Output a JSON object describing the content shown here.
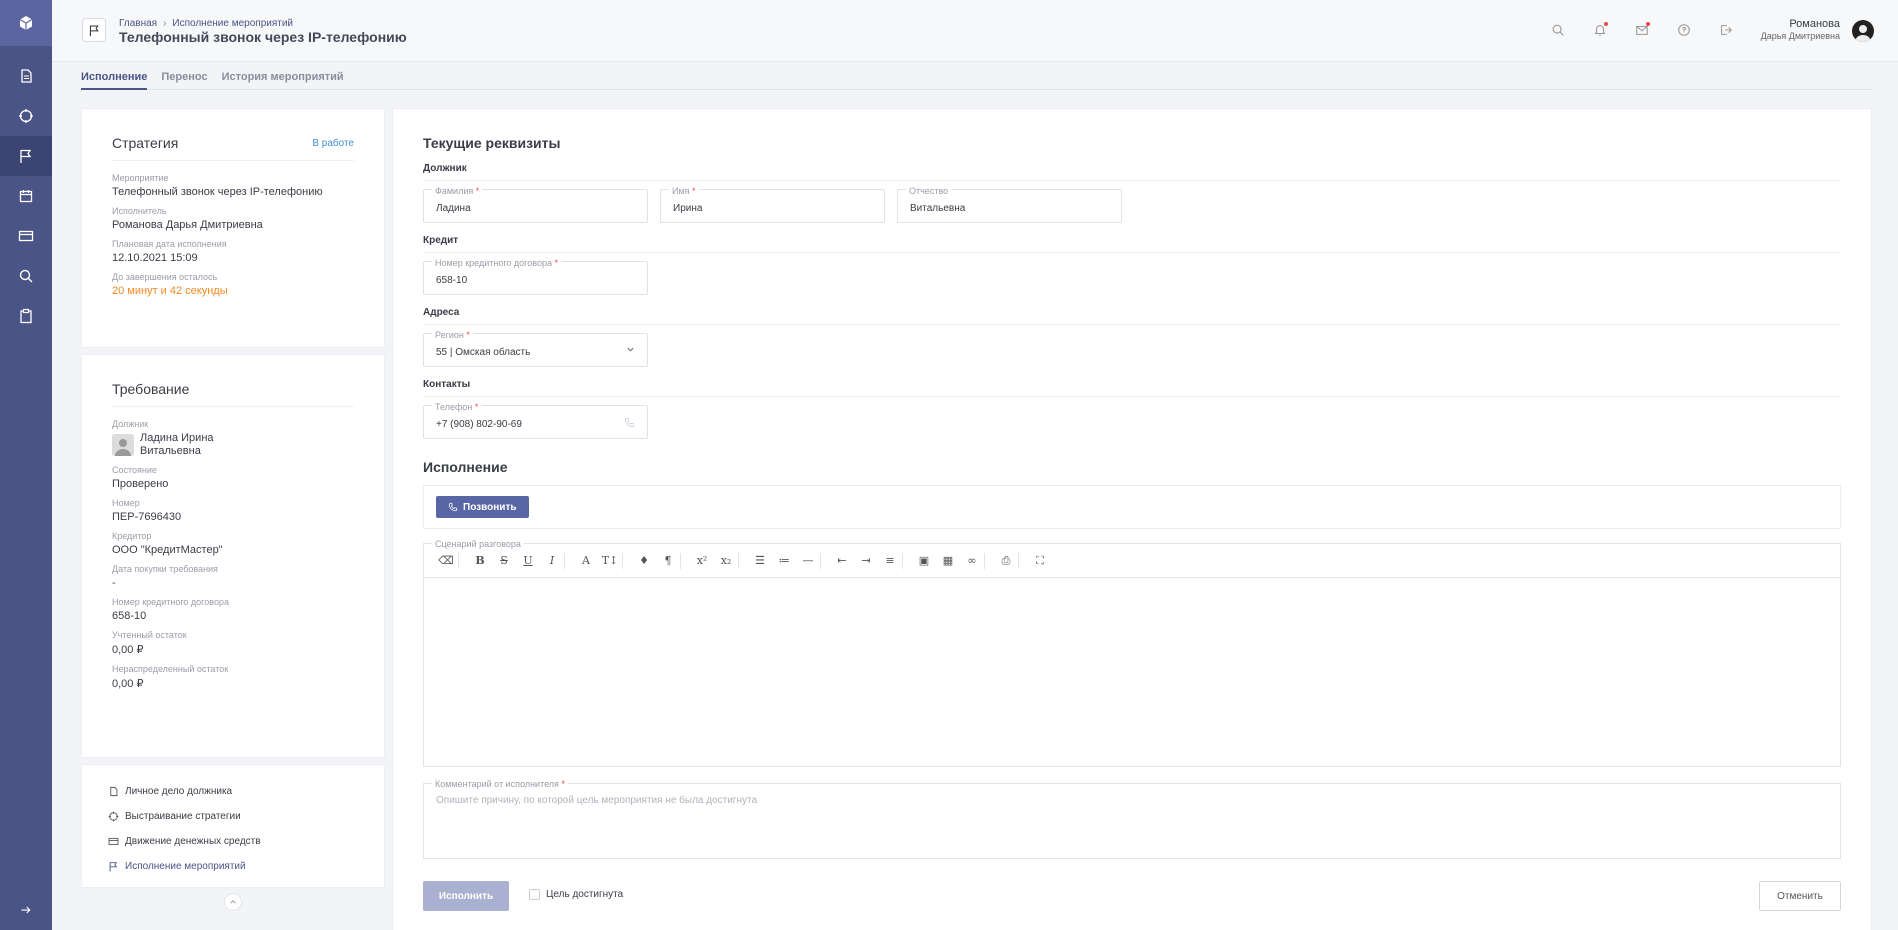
{
  "breadcrumb": {
    "home": "Главная",
    "section": "Исполнение мероприятий"
  },
  "page_title": "Телефонный звонок через IP-телефонию",
  "user": {
    "surname": "Романова",
    "name": "Дарья Дмитриевна"
  },
  "tabs": [
    {
      "label": "Исполнение",
      "active": true
    },
    {
      "label": "Перенос",
      "active": false
    },
    {
      "label": "История мероприятий",
      "active": false
    }
  ],
  "strategy": {
    "title": "Стратегия",
    "status": "В работе",
    "fields": [
      {
        "label": "Мероприятие",
        "value": "Телефонный звонок через IP-телефонию"
      },
      {
        "label": "Исполнитель",
        "value": "Романова Дарья Дмитриевна"
      },
      {
        "label": "Плановая дата исполнения",
        "value": "12.10.2021 15:09"
      },
      {
        "label": "До завершения осталось",
        "value": "20 минут и 42 секунды"
      }
    ]
  },
  "requirement": {
    "title": "Требование",
    "debtor_label": "Должник",
    "debtor_line1": "Ладина Ирина",
    "debtor_line2": "Витальевна",
    "fields": [
      {
        "label": "Состояние",
        "value": "Проверено"
      },
      {
        "label": "Номер",
        "value": "ПЕР-7696430"
      },
      {
        "label": "Кредитор",
        "value": "ООО \"КредитМастер\""
      },
      {
        "label": "Дата покупки требования",
        "value": "-"
      },
      {
        "label": "Номер кредитного договора",
        "value": "658-10"
      },
      {
        "label": "Учтенный остаток",
        "value": "0,00 ₽"
      },
      {
        "label": "Нераспределенный остаток",
        "value": "0,00 ₽"
      }
    ]
  },
  "links": [
    {
      "label": "Личное дело должника",
      "icon": "document-icon"
    },
    {
      "label": "Выстраивание стратегии",
      "icon": "target-icon"
    },
    {
      "label": "Движение денежных средств",
      "icon": "card-icon"
    },
    {
      "label": "Исполнение мероприятий",
      "icon": "flag-icon"
    }
  ],
  "main": {
    "title": "Текущие реквизиты",
    "debtor_group": "Должник",
    "surname_label": "Фамилия",
    "surname_value": "Ладина",
    "name_label": "Имя",
    "name_value": "Ирина",
    "patronymic_label": "Отчество",
    "patronymic_value": "Витальевна",
    "credit_group": "Кредит",
    "contract_label": "Номер кредитного договора",
    "contract_value": "658-10",
    "address_group": "Адреса",
    "region_label": "Регион",
    "region_value": "55 | Омская область",
    "contacts_group": "Контакты",
    "phone_label": "Телефон",
    "phone_value": "+7 (908) 802-90-69",
    "execution_title": "Исполнение",
    "call_button": "Позвонить",
    "script_label": "Сценарий разговора",
    "comment_label": "Комментарий от исполнителя",
    "comment_placeholder": "Опишите причину, по которой цель мероприятия не была достигнута",
    "execute_button": "Исполнить",
    "goal_label": "Цель достигнута",
    "cancel_button": "Отменить"
  },
  "toolbar": {
    "bold": "B",
    "strike": "S",
    "underline": "U",
    "italic": "I",
    "font": "A",
    "size": "T↕",
    "pilcrow": "¶",
    "superscript": "x²",
    "subscript": "x₂"
  }
}
